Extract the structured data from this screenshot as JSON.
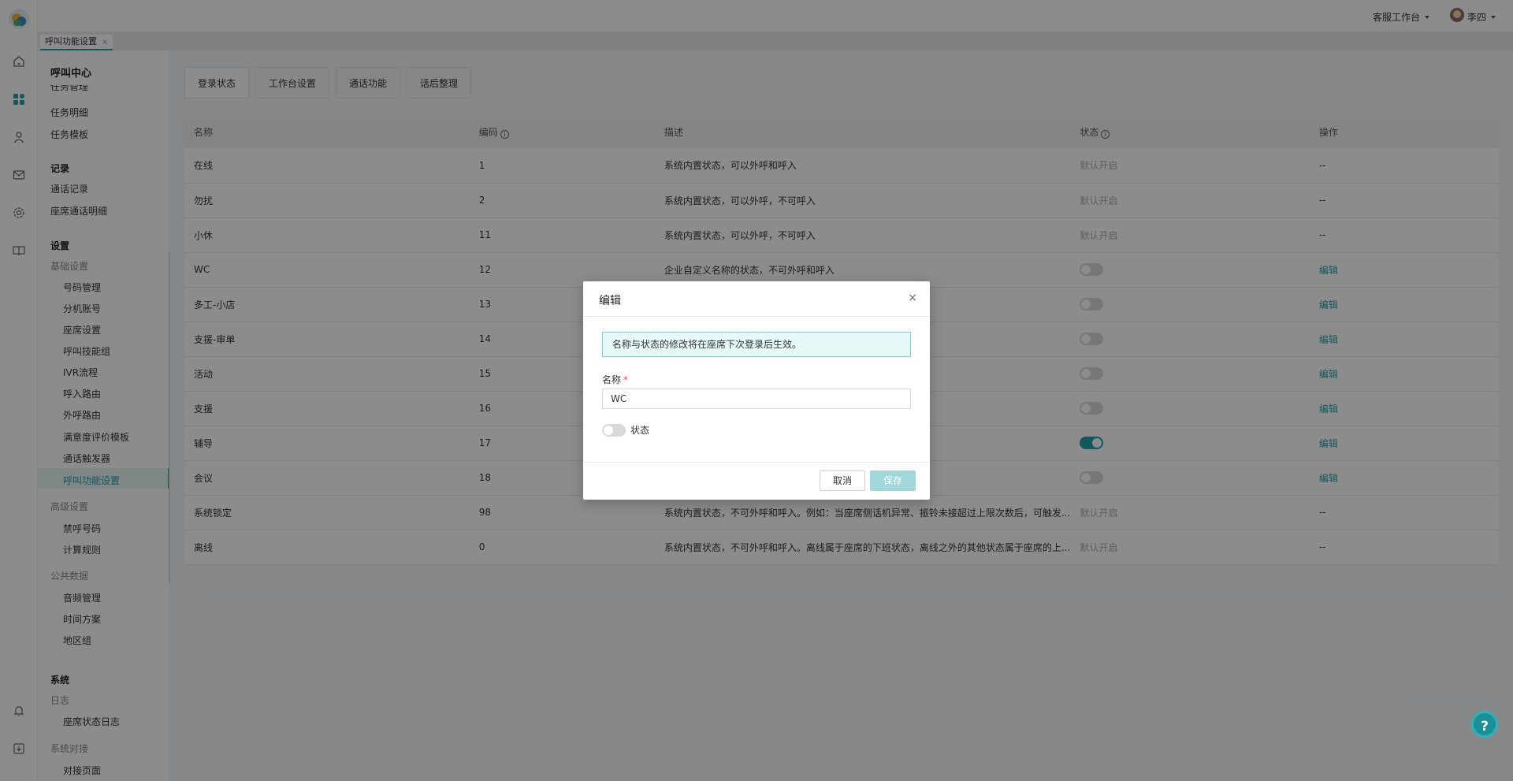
{
  "topbar": {
    "workspace": "客服工作台",
    "user": "李四"
  },
  "tabstrip": {
    "active_tab": "呼叫功能设置",
    "close": "×"
  },
  "nav": {
    "title": "呼叫中心",
    "task_partial": "任务管理",
    "task_detail": "任务明细",
    "task_template": "任务模板",
    "records": "记录",
    "call_records": "通话记录",
    "agent_call_detail": "座席通话明细",
    "settings": "设置",
    "basic_settings": "基础设置",
    "number_mgmt": "号码管理",
    "extension": "分机账号",
    "agent_settings": "座席设置",
    "skill_group": "呼叫技能组",
    "ivr": "IVR流程",
    "inbound_route": "呼入路由",
    "outbound_route": "外呼路由",
    "satisfaction": "满意度评价模板",
    "call_trigger": "通话触发器",
    "call_function": "呼叫功能设置",
    "advanced_settings": "高级设置",
    "blocked_numbers": "禁呼号码",
    "billing": "计算规则",
    "public_data": "公共数据",
    "audio": "音频管理",
    "time_plan": "时间方案",
    "region_group": "地区组",
    "system": "系统",
    "logs": "日志",
    "agent_status_log": "座席状态日志",
    "system_integration": "系统对接",
    "integration_page": "对接页面"
  },
  "subtabs": [
    "登录状态",
    "工作台设置",
    "通话功能",
    "话后整理"
  ],
  "table": {
    "headers": {
      "name": "名称",
      "code": "编码",
      "desc": "描述",
      "status": "状态",
      "action": "操作"
    },
    "rows": [
      {
        "name": "在线",
        "code": "1",
        "desc": "系统内置状态，可以外呼和呼入",
        "status": "默认开启",
        "action": "--"
      },
      {
        "name": "勿扰",
        "code": "2",
        "desc": "系统内置状态，可以外呼，不可呼入",
        "status": "默认开启",
        "action": "--"
      },
      {
        "name": "小休",
        "code": "11",
        "desc": "系统内置状态，可以外呼，不可呼入",
        "status": "默认开启",
        "action": "--"
      },
      {
        "name": "WC",
        "code": "12",
        "desc": "企业自定义名称的状态，不可外呼和呼入",
        "toggle": false,
        "action": "编辑"
      },
      {
        "name": "多工-小店",
        "code": "13",
        "desc": "",
        "toggle": false,
        "action": "编辑"
      },
      {
        "name": "支援-审单",
        "code": "14",
        "desc": "",
        "toggle": false,
        "action": "编辑"
      },
      {
        "name": "活动",
        "code": "15",
        "desc": "",
        "toggle": false,
        "action": "编辑"
      },
      {
        "name": "支援",
        "code": "16",
        "desc": "",
        "toggle": false,
        "action": "编辑"
      },
      {
        "name": "辅导",
        "code": "17",
        "desc": "",
        "toggle": true,
        "action": "编辑"
      },
      {
        "name": "会议",
        "code": "18",
        "desc": "",
        "toggle": false,
        "action": "编辑"
      },
      {
        "name": "系统锁定",
        "code": "98",
        "desc": "系统内置状态，不可外呼和呼入。例如：当座席侧话机异常、振铃未接超过上限次数后，可触发...",
        "status": "默认开启",
        "action": "--"
      },
      {
        "name": "离线",
        "code": "0",
        "desc": "系统内置状态，不可外呼和呼入。离线属于座席的下班状态，离线之外的其他状态属于座席的上...",
        "status": "默认开启",
        "action": "--"
      }
    ]
  },
  "modal": {
    "title": "编辑",
    "close": "×",
    "notice": "名称与状态的修改将在座席下次登录后生效。",
    "name_label": "名称",
    "required_mark": "*",
    "name_value": "WC",
    "status_label": "状态",
    "status_on": false,
    "cancel": "取消",
    "save": "保存"
  },
  "help": "?"
}
